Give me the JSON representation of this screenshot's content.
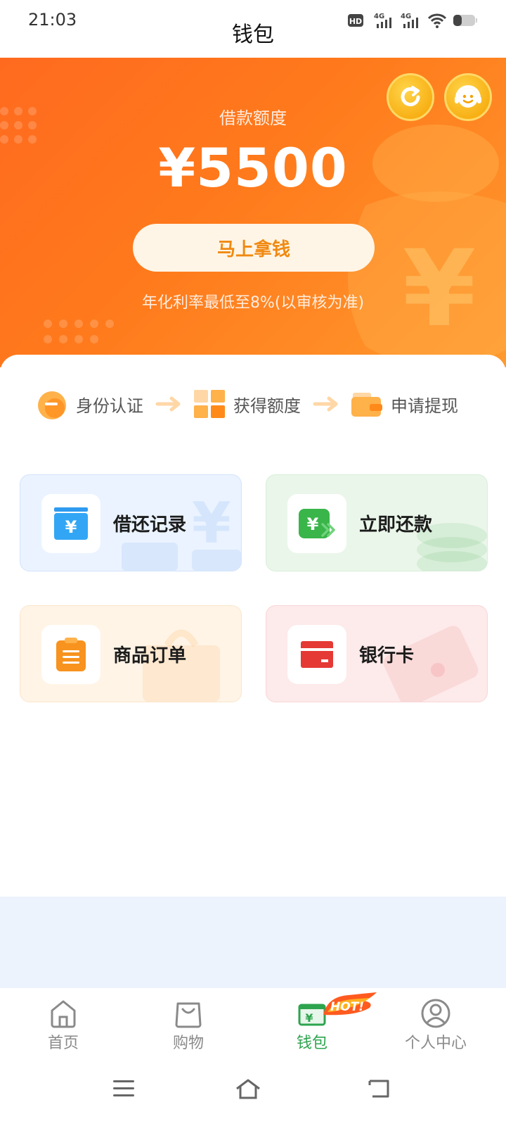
{
  "status_bar": {
    "time": "21:03",
    "hd_label": "HD",
    "net1": "4G",
    "net2": "4G"
  },
  "header": {
    "title": "钱包"
  },
  "hero": {
    "credit_label": "借款额度",
    "credit_amount": "¥5500",
    "cta_label": "马上拿钱",
    "rate_note": "年化利率最低至8%(以审核为准)",
    "icons": [
      "refresh-icon",
      "customer-service-icon"
    ]
  },
  "steps": [
    {
      "label": "身份认证",
      "icon": "identity-icon"
    },
    {
      "label": "获得额度",
      "icon": "credit-icon"
    },
    {
      "label": "申请提现",
      "icon": "wallet-icon"
    }
  ],
  "tiles": [
    {
      "label": "借还记录",
      "icon": "yuan-card-icon",
      "accent": "#2e9bf0"
    },
    {
      "label": "立即还款",
      "icon": "repay-icon",
      "accent": "#39b54a"
    },
    {
      "label": "商品订单",
      "icon": "clipboard-icon",
      "accent": "#f7931e"
    },
    {
      "label": "银行卡",
      "icon": "bank-card-icon",
      "accent": "#e53935"
    }
  ],
  "tab_bar": {
    "items": [
      {
        "label": "首页",
        "icon": "home-icon",
        "active": false
      },
      {
        "label": "购物",
        "icon": "shopping-bag-icon",
        "active": false
      },
      {
        "label": "钱包",
        "icon": "wallet-icon",
        "active": true,
        "badge": "HOT!"
      },
      {
        "label": "个人中心",
        "icon": "person-icon",
        "active": false
      }
    ]
  },
  "colors": {
    "hero_start": "#ff6a1f",
    "hero_end": "#ff9a2e",
    "cta_text": "#f08a12",
    "active_tab": "#2ea44f"
  }
}
